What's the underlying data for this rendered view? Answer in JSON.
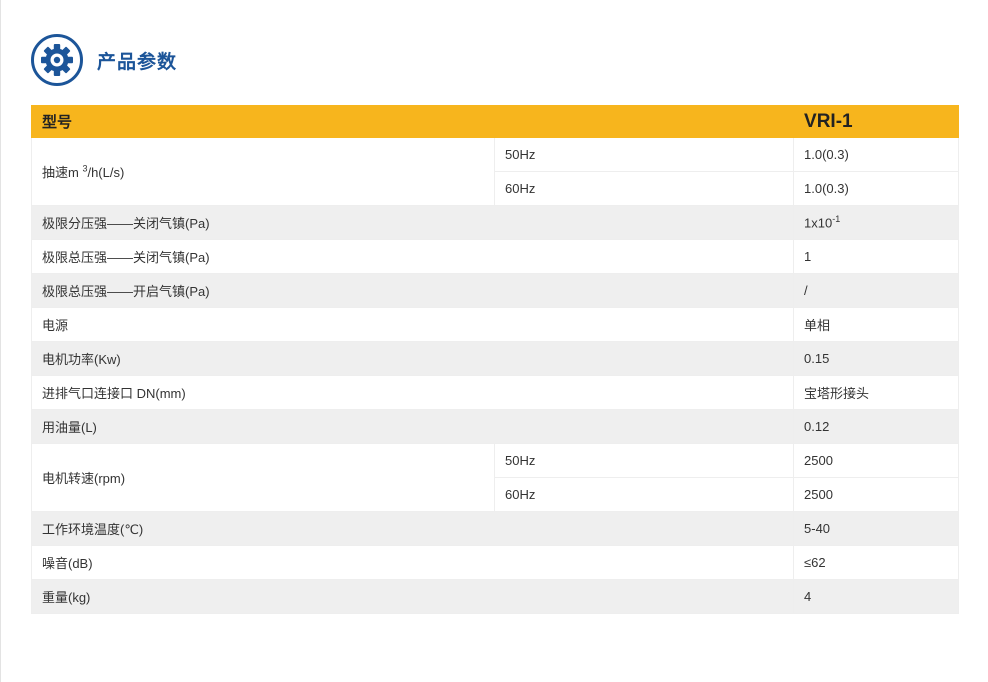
{
  "section_title": "产品参数",
  "icon": "gear-icon",
  "colors": {
    "accent": "#1c5599",
    "header_bg": "#f7b51d",
    "stripe": "#efefef"
  },
  "table": {
    "header": {
      "label": "型号",
      "model": "VRI-1"
    },
    "pumping_speed": {
      "label_prefix": "抽速m ",
      "label_sup": "3",
      "label_suffix": "/h(L/s)",
      "rows": [
        {
          "freq": "50Hz",
          "value": "1.0(0.3)"
        },
        {
          "freq": "60Hz",
          "value": "1.0(0.3)"
        }
      ]
    },
    "partial_pressure": {
      "label": "极限分压强——关闭气镇(Pa)",
      "value_base": "1x10",
      "value_exp": "-1"
    },
    "total_pressure_closed": {
      "label": "极限总压强——关闭气镇(Pa)",
      "value": "1"
    },
    "total_pressure_open": {
      "label": "极限总压强——开启气镇(Pa)",
      "value": "/"
    },
    "power_supply": {
      "label": "电源",
      "value": "单相"
    },
    "motor_power": {
      "label": "电机功率(Kw)",
      "value": "0.15"
    },
    "port": {
      "label": "进排气口连接口 DN(mm)",
      "value": "宝塔形接头"
    },
    "oil": {
      "label": "用油量(L)",
      "value": "0.12"
    },
    "motor_speed": {
      "label": "电机转速(rpm)",
      "rows": [
        {
          "freq": "50Hz",
          "value": "2500"
        },
        {
          "freq": "60Hz",
          "value": "2500"
        }
      ]
    },
    "temperature": {
      "label": "工作环境温度(℃)",
      "value": "5-40"
    },
    "noise": {
      "label": "噪音(dB)",
      "value": "≤62"
    },
    "weight": {
      "label": "重量(kg)",
      "value": "4"
    }
  }
}
